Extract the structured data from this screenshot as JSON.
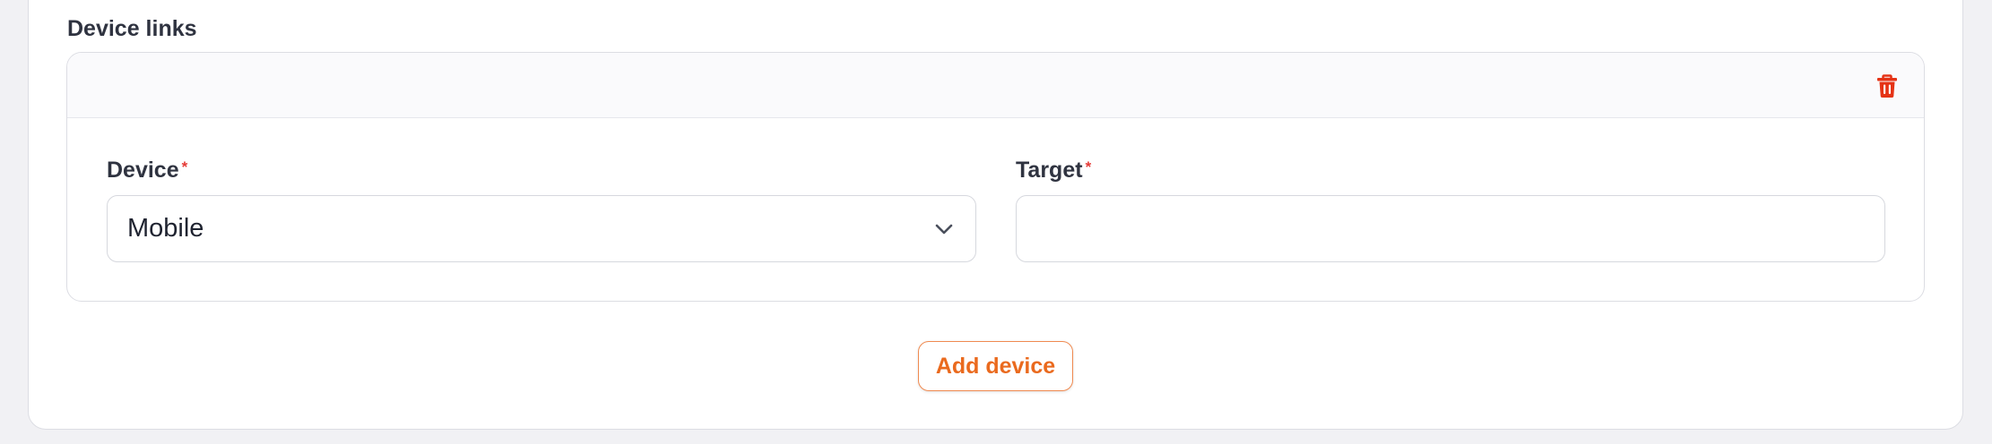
{
  "section": {
    "title": "Device links"
  },
  "repeater_item": {
    "delete_icon": "trash-icon",
    "delete_color": "#e53316",
    "device_field": {
      "label": "Device",
      "required_mark": "*",
      "value": "Mobile",
      "icon": "chevron-down-icon"
    },
    "target_field": {
      "label": "Target",
      "required_mark": "*",
      "value": "",
      "placeholder": ""
    }
  },
  "actions": {
    "add_label": "Add device",
    "accent": "#ea6a1e"
  }
}
